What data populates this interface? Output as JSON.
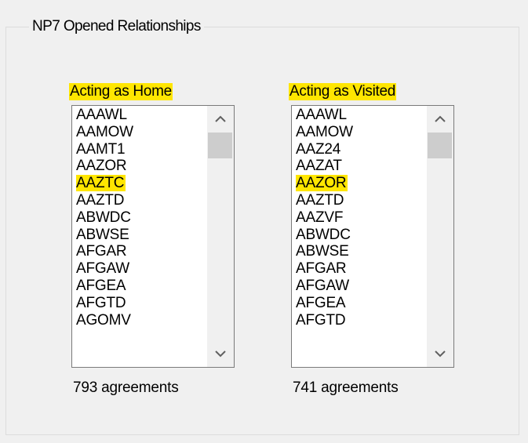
{
  "group": {
    "title": "NP7 Opened Relationships"
  },
  "home": {
    "label": "Acting as Home",
    "items": [
      "AAAWL",
      "AAMOW",
      "AAMT1",
      "AAZOR",
      "AAZTC",
      "AAZTD",
      "ABWDC",
      "ABWSE",
      "AFGAR",
      "AFGAW",
      "AFGEA",
      "AFGTD",
      "AGOMV"
    ],
    "selected": "AAZTC",
    "count": "793 agreements"
  },
  "visited": {
    "label": "Acting as Visited",
    "items": [
      "AAAWL",
      "AAMOW",
      "AAZ24",
      "AAZAT",
      "AAZOR",
      "AAZTD",
      "AAZVF",
      "ABWDC",
      "ABWSE",
      "AFGAR",
      "AFGAW",
      "AFGEA",
      "AFGTD"
    ],
    "selected": "AAZOR",
    "count": "741 agreements"
  },
  "colors": {
    "highlight": "#ffe600",
    "window_bg": "#f0f0f0",
    "list_border": "#7a7a7a",
    "scroll_thumb": "#cdcdcd"
  },
  "icons": {
    "scroll_up": "chevron-up-icon",
    "scroll_down": "chevron-down-icon"
  }
}
